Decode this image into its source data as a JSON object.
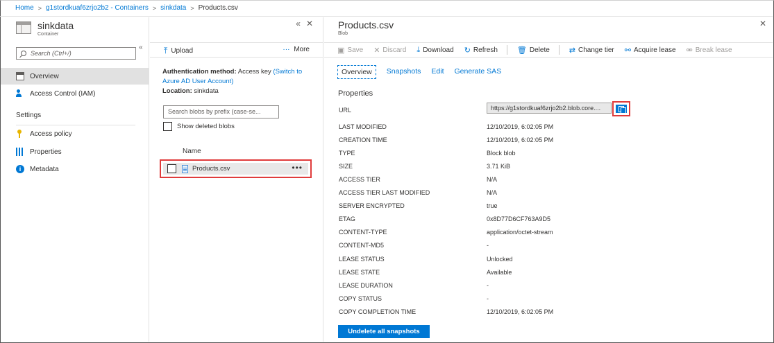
{
  "breadcrumb": {
    "home": "Home",
    "account": "g1stordkuaf6zrjo2b2 - Containers",
    "container": "sinkdata",
    "file": "Products.csv"
  },
  "container_pane": {
    "title": "sinkdata",
    "subtitle": "Container",
    "search_placeholder": "Search (Ctrl+/)",
    "nav": [
      {
        "label": "Overview",
        "icon": "overview-icon",
        "active": true
      },
      {
        "label": "Access Control (IAM)",
        "icon": "people-icon"
      }
    ],
    "settings_label": "Settings",
    "settings_nav": [
      {
        "label": "Access policy",
        "icon": "key-icon"
      },
      {
        "label": "Properties",
        "icon": "properties-icon"
      },
      {
        "label": "Metadata",
        "icon": "info-icon"
      }
    ]
  },
  "blob_list": {
    "upload_label": "Upload",
    "more_label": "More",
    "auth_label": "Authentication method:",
    "auth_value": "Access key",
    "auth_link": "(Switch to Azure AD User Account)",
    "location_label": "Location:",
    "location_value": "sinkdata",
    "search_placeholder": "Search blobs by prefix (case-se...",
    "show_deleted_label": "Show deleted blobs",
    "column_name": "Name",
    "rows": [
      {
        "name": "Products.csv"
      }
    ]
  },
  "blob_pane": {
    "title": "Products.csv",
    "subtitle": "Blob",
    "toolbar": {
      "save": "Save",
      "discard": "Discard",
      "download": "Download",
      "refresh": "Refresh",
      "delete": "Delete",
      "change_tier": "Change tier",
      "acquire_lease": "Acquire lease",
      "break_lease": "Break lease"
    },
    "tabs": [
      "Overview",
      "Snapshots",
      "Edit",
      "Generate SAS"
    ],
    "section_title": "Properties",
    "url_label": "URL",
    "url_value": "https://g1stordkuaf6zrjo2b2.blob.core....",
    "properties": [
      {
        "label": "LAST MODIFIED",
        "value": "12/10/2019, 6:02:05 PM"
      },
      {
        "label": "CREATION TIME",
        "value": "12/10/2019, 6:02:05 PM"
      },
      {
        "label": "TYPE",
        "value": "Block blob"
      },
      {
        "label": "SIZE",
        "value": "3.71 KiB"
      },
      {
        "label": "ACCESS TIER",
        "value": "N/A"
      },
      {
        "label": "ACCESS TIER LAST MODIFIED",
        "value": "N/A"
      },
      {
        "label": "SERVER ENCRYPTED",
        "value": "true"
      },
      {
        "label": "ETAG",
        "value": "0x8D77D6CF763A9D5"
      },
      {
        "label": "CONTENT-TYPE",
        "value": "application/octet-stream"
      },
      {
        "label": "CONTENT-MD5",
        "value": "-"
      },
      {
        "label": "LEASE STATUS",
        "value": "Unlocked"
      },
      {
        "label": "LEASE STATE",
        "value": "Available"
      },
      {
        "label": "LEASE DURATION",
        "value": "-"
      },
      {
        "label": "COPY STATUS",
        "value": "-"
      },
      {
        "label": "COPY COMPLETION TIME",
        "value": "12/10/2019, 6:02:05 PM"
      }
    ],
    "undelete_label": "Undelete all snapshots"
  },
  "colors": {
    "accent": "#0078d4",
    "highlight": "#e03b3b",
    "selected_row": "#e8e8e8"
  }
}
